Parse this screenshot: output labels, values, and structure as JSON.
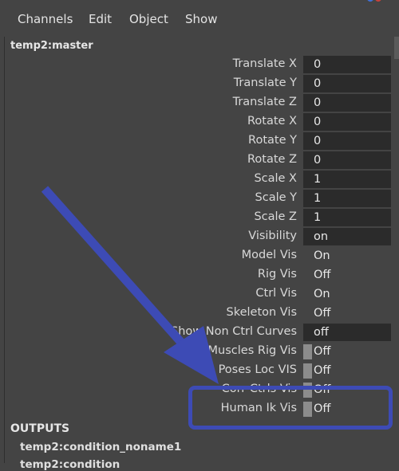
{
  "menu": {
    "items": [
      {
        "label": "Channels"
      },
      {
        "label": "Edit"
      },
      {
        "label": "Object"
      },
      {
        "label": "Show"
      }
    ]
  },
  "object_name": "temp2:master",
  "channels": [
    {
      "label": "Translate X",
      "value": "0",
      "style": "boxed"
    },
    {
      "label": "Translate Y",
      "value": "0",
      "style": "boxed"
    },
    {
      "label": "Translate Z",
      "value": "0",
      "style": "boxed"
    },
    {
      "label": "Rotate X",
      "value": "0",
      "style": "boxed"
    },
    {
      "label": "Rotate Y",
      "value": "0",
      "style": "boxed"
    },
    {
      "label": "Rotate Z",
      "value": "0",
      "style": "boxed"
    },
    {
      "label": "Scale X",
      "value": "1",
      "style": "boxed"
    },
    {
      "label": "Scale Y",
      "value": "1",
      "style": "boxed"
    },
    {
      "label": "Scale Z",
      "value": "1",
      "style": "boxed"
    },
    {
      "label": "Visibility",
      "value": "on",
      "style": "boxed"
    },
    {
      "label": "Model Vis",
      "value": "On",
      "style": "plain"
    },
    {
      "label": "Rig Vis",
      "value": "Off",
      "style": "plain"
    },
    {
      "label": "Ctrl Vis",
      "value": "On",
      "style": "plain"
    },
    {
      "label": "Skeleton Vis",
      "value": "Off",
      "style": "plain"
    },
    {
      "label": "Show Non Ctrl Curves",
      "value": "off",
      "style": "boxed"
    },
    {
      "label": "Muscles Rig Vis",
      "value": "Off",
      "style": "switch"
    },
    {
      "label": "Poses Loc VIS",
      "value": "Off",
      "style": "switch"
    },
    {
      "label": "Corr Ctrls Vis",
      "value": "Off",
      "style": "switch"
    },
    {
      "label": "Human Ik Vis",
      "value": "Off",
      "style": "switch"
    }
  ],
  "outputs": {
    "title": "OUTPUTS",
    "nodes": [
      "temp2:condition_noname1",
      "temp2:condition"
    ]
  },
  "annotation": {
    "arrow_color": "#3d4bb5",
    "box_color": "#3d4bb5"
  }
}
